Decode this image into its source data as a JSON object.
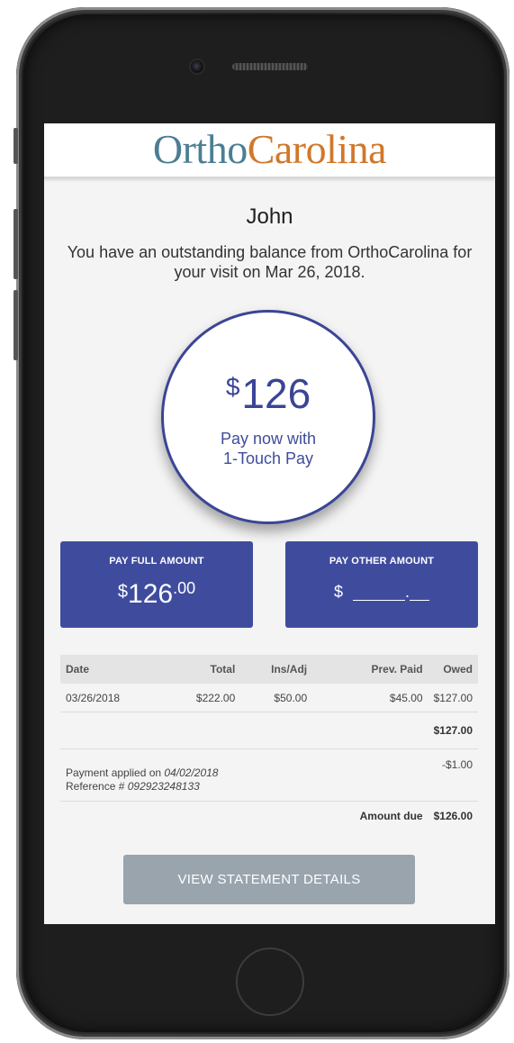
{
  "logo": {
    "part1": "Ortho",
    "part2": "Carolina"
  },
  "greeting": {
    "name": "John",
    "message": "You have an outstanding balance from OrthoCarolina for your visit on Mar 26, 2018."
  },
  "balance": {
    "currency": "$",
    "amount": "126",
    "cta_line1": "Pay now with",
    "cta_line2": "1-Touch Pay"
  },
  "pay_full": {
    "title": "PAY FULL AMOUNT",
    "currency": "$",
    "amount": "126",
    "cents": ".00"
  },
  "pay_other": {
    "title": "PAY OTHER AMOUNT",
    "currency": "$",
    "separator": "."
  },
  "table": {
    "headers": [
      "Date",
      "Total",
      "Ins/Adj",
      "Prev. Paid",
      "Owed"
    ],
    "row": [
      "03/26/2018",
      "$222.00",
      "$50.00",
      "$45.00",
      "$127.00"
    ],
    "subtotal": "$127.00",
    "payment": {
      "applied_label": "Payment applied on",
      "applied_date": "04/02/2018",
      "reference_label": "Reference #",
      "reference": "092923248133",
      "amount": "-$1.00"
    },
    "amount_due_label": "Amount due",
    "amount_due": "$126.00"
  },
  "view_button": "VIEW STATEMENT DETAILS",
  "colors": {
    "primary": "#3f4c9e",
    "logo_blue": "#4b7e92",
    "logo_orange": "#d0782b",
    "button_gray": "#99a4ad"
  }
}
